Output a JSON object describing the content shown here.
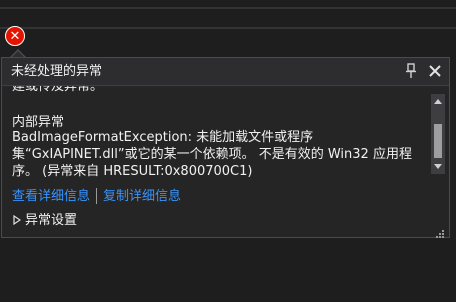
{
  "popup": {
    "title": "未经处理的异常",
    "clipped_line": "建或传及异常。",
    "section_heading": "内部异常",
    "message_lines": [
      "BadImageFormatException: 未能加载文件或程序",
      "集“GxIAPINET.dll”或它的某一个依赖项。 不是有效的 Win32 应用程",
      "序。 (异常来自 HRESULT:0x800700C1)"
    ],
    "links": {
      "view_details": "查看详细信息",
      "copy_details": "复制详细信息"
    },
    "exception_settings": "异常设置"
  },
  "colors": {
    "background": "#1e1e1e",
    "popup_background": "#252526",
    "titlebar_background": "#2d2d30",
    "text": "#f1f1f1",
    "link": "#3794ff",
    "error": "#e51400"
  },
  "icons": {
    "error": "error-x-icon",
    "pin": "pin-icon",
    "close": "close-icon",
    "expander": "chevron-right-icon",
    "scroll_up": "chevron-up-icon",
    "scroll_down": "chevron-down-icon",
    "resize": "resize-grip-icon"
  }
}
